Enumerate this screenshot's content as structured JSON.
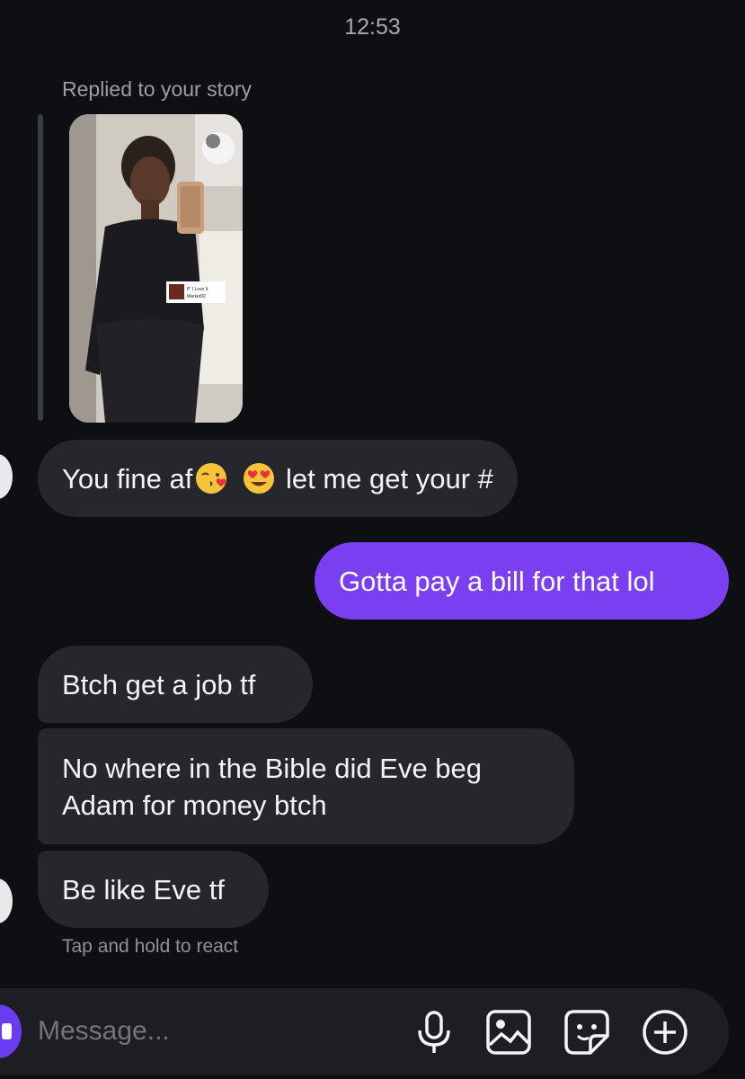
{
  "status": {
    "time": "12:53"
  },
  "story_reply": {
    "label": "Replied to your story",
    "sticker_line1": "P' I Love It",
    "sticker_line2": "Market92"
  },
  "messages": [
    {
      "direction": "incoming",
      "parts": [
        "You fine af",
        "kissing-face-emoji",
        "heart-eyes-emoji",
        " let me get your #"
      ],
      "text_before": "You fine af",
      "text_after": " let me get your #"
    },
    {
      "direction": "outgoing",
      "text": "Gotta pay a bill for that lol"
    },
    {
      "direction": "incoming",
      "text": "Btch get a job tf"
    },
    {
      "direction": "incoming",
      "text_line1": "No where in the Bible did Eve beg",
      "text_line2": "Adam for money btch"
    },
    {
      "direction": "incoming",
      "text": "Be like Eve tf"
    }
  ],
  "hint": "Tap and hold to react",
  "composer": {
    "placeholder": "Message...",
    "icons": [
      "camera-icon",
      "microphone-icon",
      "gallery-icon",
      "sticker-icon",
      "add-icon"
    ]
  },
  "colors": {
    "background": "#0e0f13",
    "incoming_bubble": "#26272c",
    "outgoing_bubble": "#7b3ff2",
    "composer": "#1d1e23"
  }
}
